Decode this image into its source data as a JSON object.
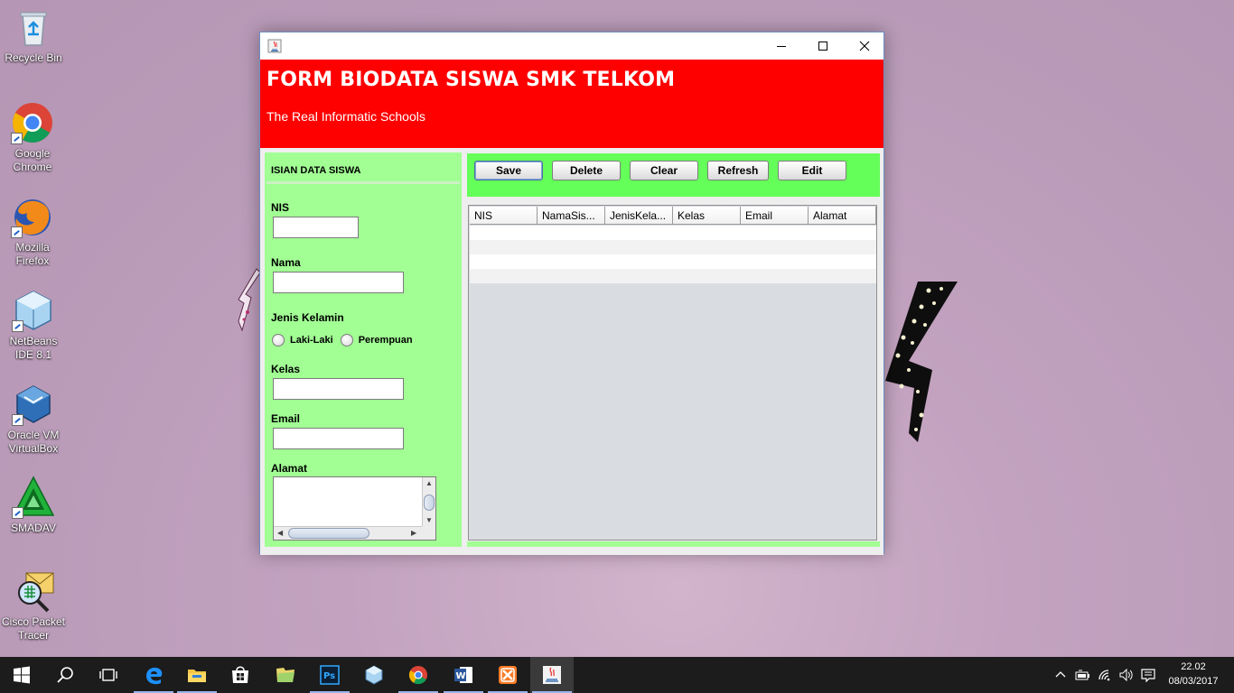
{
  "desktop": {
    "icons": [
      {
        "label": "Recycle Bin"
      },
      {
        "label": "Google Chrome"
      },
      {
        "label": "Mozilla Firefox"
      },
      {
        "label": "NetBeans IDE 8.1"
      },
      {
        "label": "Oracle VM VirtualBox"
      },
      {
        "label": "SMADAV"
      },
      {
        "label": "Cisco Packet Tracer"
      }
    ]
  },
  "window": {
    "header": {
      "title": "FORM BIODATA SISWA SMK TELKOM",
      "subtitle": "The Real Informatic Schools"
    },
    "form": {
      "section_title": "ISIAN DATA SISWA",
      "nis_label": "NIS",
      "nis_value": "",
      "nama_label": "Nama",
      "nama_value": "",
      "gender_label": "Jenis Kelamin",
      "gender_options": [
        "Laki-Laki",
        "Perempuan"
      ],
      "kelas_label": "Kelas",
      "kelas_value": "",
      "email_label": "Email",
      "email_value": "",
      "alamat_label": "Alamat",
      "alamat_value": ""
    },
    "toolbar": {
      "save_label": "Save",
      "delete_label": "Delete",
      "clear_label": "Clear",
      "refresh_label": "Refresh",
      "edit_label": "Edit"
    },
    "table": {
      "columns": [
        "NIS",
        "NamaSis...",
        "JenisKela...",
        "Kelas",
        "Email",
        "Alamat"
      ],
      "rows": [
        [
          "",
          "",
          "",
          "",
          "",
          ""
        ],
        [
          "",
          "",
          "",
          "",
          "",
          ""
        ],
        [
          "",
          "",
          "",
          "",
          "",
          ""
        ],
        [
          "",
          "",
          "",
          "",
          "",
          ""
        ]
      ]
    },
    "colors": {
      "header_bg": "#ff0000",
      "form_panel_bg": "#a2ff94",
      "toolbar_bg": "#65ff59"
    }
  },
  "taskbar": {
    "apps": [
      "start-icon",
      "search-icon",
      "task-view-icon",
      "edge-icon",
      "file-explorer-icon",
      "store-icon",
      "folder-icon",
      "photoshop-icon",
      "netbeans-icon",
      "chrome-icon",
      "word-icon",
      "xampp-icon",
      "java-icon"
    ],
    "time": "22.02",
    "date": "08/03/2017"
  }
}
